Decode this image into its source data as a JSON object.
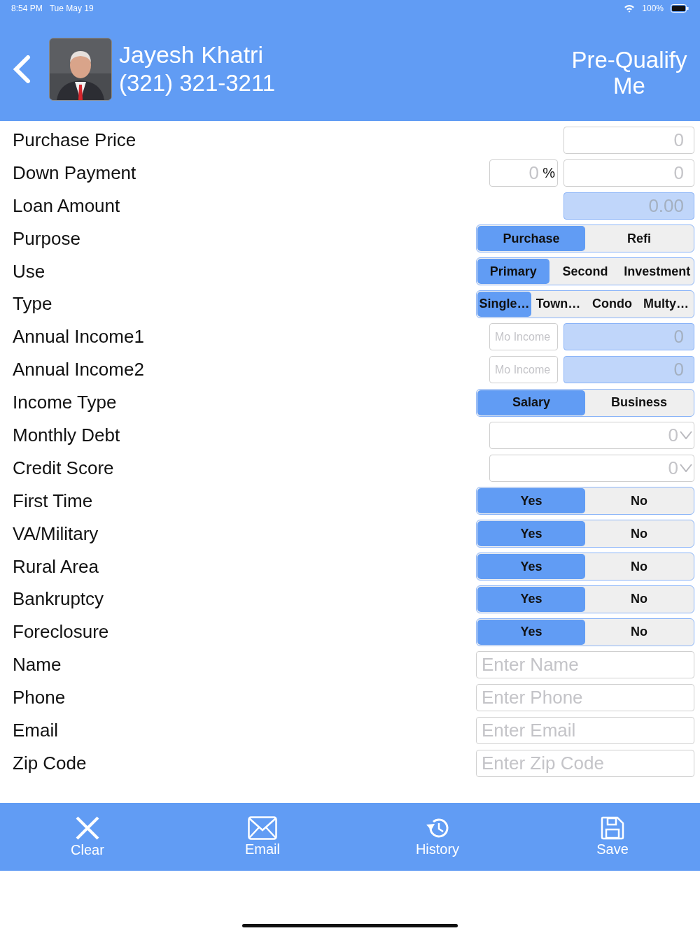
{
  "status_bar": {
    "time": "8:54 PM",
    "date": "Tue May 19",
    "battery": "100%"
  },
  "header": {
    "name": "Jayesh Khatri",
    "phone": "(321) 321-3211",
    "action": "Pre-Qualify Me"
  },
  "rows": [
    {
      "label": "Purchase Price",
      "kind": "amount",
      "placeholder": "0",
      "readonly": false
    },
    {
      "label": "Down Payment",
      "kind": "percent",
      "percent_placeholder": "0",
      "percent_sign": "%",
      "placeholder": "0"
    },
    {
      "label": "Loan Amount",
      "kind": "amount",
      "placeholder": "0.00",
      "readonly": true
    },
    {
      "label": "Purpose",
      "kind": "segmented",
      "options": [
        {
          "label": "Purchase",
          "selected": true
        },
        {
          "label": "Refi",
          "selected": false
        }
      ]
    },
    {
      "label": "Use",
      "kind": "segmented",
      "options": [
        {
          "label": "Primary",
          "selected": true
        },
        {
          "label": "Second",
          "selected": false
        },
        {
          "label": "Investment",
          "selected": false
        }
      ]
    },
    {
      "label": "Type",
      "kind": "segmented",
      "options": [
        {
          "label": "Single…",
          "selected": true
        },
        {
          "label": "Town…",
          "selected": false
        },
        {
          "label": "Condo",
          "selected": false
        },
        {
          "label": "Multy…",
          "selected": false
        }
      ]
    },
    {
      "label": "Annual Income1",
      "kind": "income",
      "monthly_placeholder": "Mo Income",
      "placeholder": "0"
    },
    {
      "label": "Annual Income2",
      "kind": "income",
      "monthly_placeholder": "Mo Income",
      "placeholder": "0"
    },
    {
      "label": "Income Type",
      "kind": "segmented",
      "options": [
        {
          "label": "Salary",
          "selected": true
        },
        {
          "label": "Business",
          "selected": false
        }
      ]
    },
    {
      "label": "Monthly Debt",
      "kind": "dropdown",
      "value": "0"
    },
    {
      "label": "Credit Score",
      "kind": "dropdown",
      "value": "0"
    },
    {
      "label": "First Time",
      "kind": "segmented",
      "options": [
        {
          "label": "Yes",
          "selected": true
        },
        {
          "label": "No",
          "selected": false
        }
      ]
    },
    {
      "label": "VA/Military",
      "kind": "segmented",
      "options": [
        {
          "label": "Yes",
          "selected": true
        },
        {
          "label": "No",
          "selected": false
        }
      ]
    },
    {
      "label": "Rural Area",
      "kind": "segmented",
      "options": [
        {
          "label": "Yes",
          "selected": true
        },
        {
          "label": "No",
          "selected": false
        }
      ]
    },
    {
      "label": "Bankruptcy",
      "kind": "segmented",
      "options": [
        {
          "label": "Yes",
          "selected": true
        },
        {
          "label": "No",
          "selected": false
        }
      ]
    },
    {
      "label": "Foreclosure",
      "kind": "segmented",
      "options": [
        {
          "label": "Yes",
          "selected": true
        },
        {
          "label": "No",
          "selected": false
        }
      ]
    },
    {
      "label": "Name",
      "kind": "text",
      "placeholder": "Enter Name"
    },
    {
      "label": "Phone",
      "kind": "text",
      "placeholder": "Enter Phone"
    },
    {
      "label": "Email",
      "kind": "text",
      "placeholder": "Enter Email"
    },
    {
      "label": "Zip Code",
      "kind": "text",
      "placeholder": "Enter Zip Code"
    }
  ],
  "toolbar": [
    {
      "label": "Clear"
    },
    {
      "label": "Email"
    },
    {
      "label": "History"
    },
    {
      "label": "Save"
    }
  ]
}
